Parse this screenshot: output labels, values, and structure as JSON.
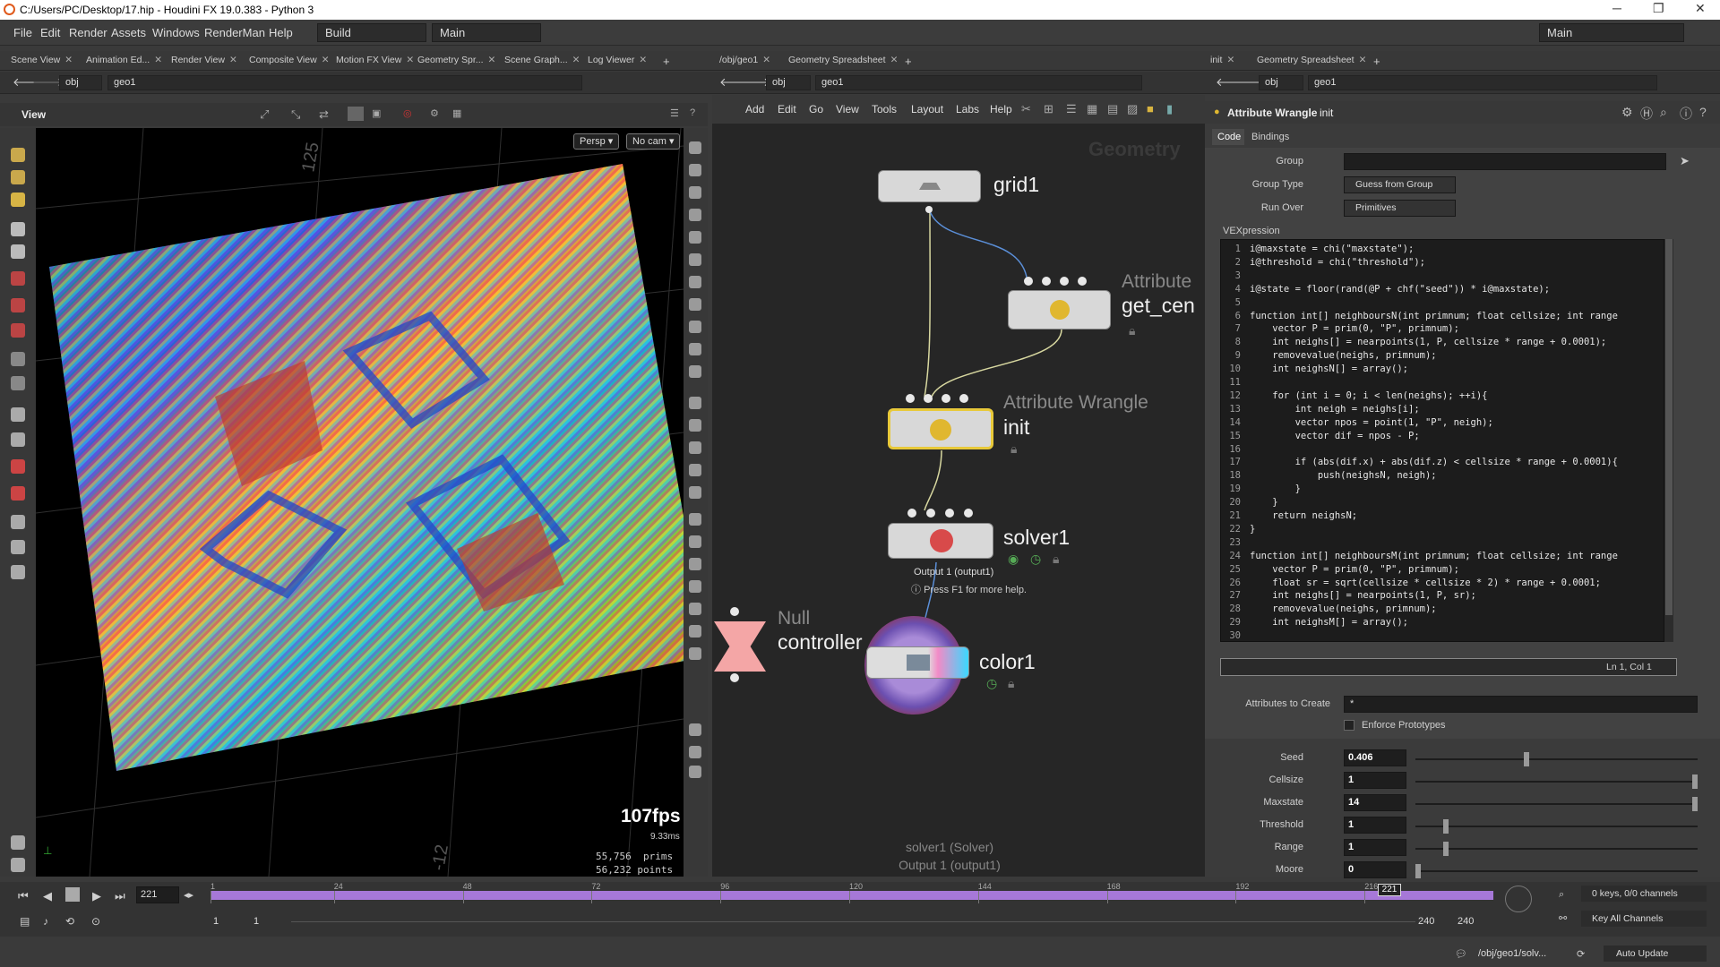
{
  "window": {
    "title": "C:/Users/PC/Desktop/17.hip - Houdini FX 19.0.383 - Python 3",
    "minimize": "─",
    "restore": "❐",
    "close": "✕"
  },
  "menu": {
    "items": [
      "File",
      "Edit",
      "Render",
      "Assets",
      "Windows",
      "RenderMan",
      "Help"
    ],
    "desktop1": "Build",
    "desktop2": "Main",
    "desktop3": "Main"
  },
  "pane_tabs_left": [
    "Scene View",
    "Animation Ed...",
    "Render View",
    "Composite View",
    "Motion FX View",
    "Geometry Spr...",
    "Scene Graph...",
    "Log Viewer"
  ],
  "pane_tabs_mid": [
    "/obj/geo1",
    "Geometry Spreadsheet"
  ],
  "pane_tabs_right": [
    "init",
    "Geometry Spreadsheet"
  ],
  "path": {
    "obj": "obj",
    "geo": "geo1"
  },
  "viewer": {
    "title": "View",
    "persp": "Persp",
    "cam": "No cam",
    "fps": "107fps",
    "ms": "9.33ms",
    "prims_count": "55,756",
    "prims_label": "prims",
    "points_count": "56,232",
    "points_label": "points",
    "grid_label1": "125",
    "grid_label2": "-12"
  },
  "network": {
    "menu": [
      "Add",
      "Edit",
      "Go",
      "View",
      "Tools",
      "Layout",
      "Labs",
      "Help"
    ],
    "watermark": "Geometry",
    "nodes": {
      "grid": "grid1",
      "attr_type": "Attribute",
      "attr_name": "get_cen",
      "init_type": "Attribute Wrangle",
      "init_name": "init",
      "solver": "solver1",
      "solver_out": "Output 1 (output1)",
      "help": "Press F1 for more help.",
      "null_type": "Null",
      "null_name": "controller",
      "color": "color1"
    },
    "footer1": "solver1 (Solver)",
    "footer2": "Output 1 (output1)"
  },
  "params": {
    "node_type": "Attribute Wrangle",
    "node_name": "init",
    "tabs": [
      "Code",
      "Bindings"
    ],
    "group_label": "Group",
    "group_value": "",
    "group_type_label": "Group Type",
    "group_type_value": "Guess from Group",
    "run_over_label": "Run Over",
    "run_over_value": "Primitives",
    "vex_label": "VEXpression",
    "cursor": "Ln 1, Col 1",
    "attr_create_label": "Attributes to Create",
    "attr_create_value": "*",
    "enforce_label": "Enforce Prototypes",
    "sliders": [
      {
        "label": "Seed",
        "value": "0.406",
        "level": 0.39
      },
      {
        "label": "Cellsize",
        "value": "1",
        "level": 1.0
      },
      {
        "label": "Maxstate",
        "value": "14",
        "level": 1.0
      },
      {
        "label": "Threshold",
        "value": "1",
        "level": 0.1
      },
      {
        "label": "Range",
        "value": "1",
        "level": 0.1
      },
      {
        "label": "Moore",
        "value": "0",
        "level": 0.0
      }
    ]
  },
  "code_lines": [
    "i@maxstate = chi(\"maxstate\");",
    "i@threshold = chi(\"threshold\");",
    "",
    "i@state = floor(rand(@P + chf(\"seed\")) * i@maxstate);",
    "",
    "function int[] neighboursN(int primnum; float cellsize; int range",
    "    vector P = prim(0, \"P\", primnum);",
    "    int neighs[] = nearpoints(1, P, cellsize * range + 0.0001);",
    "    removevalue(neighs, primnum);",
    "    int neighsN[] = array();",
    "",
    "    for (int i = 0; i < len(neighs); ++i){",
    "        int neigh = neighs[i];",
    "        vector npos = point(1, \"P\", neigh);",
    "        vector dif = npos - P;",
    "",
    "        if (abs(dif.x) + abs(dif.z) < cellsize * range + 0.0001){",
    "            push(neighsN, neigh);",
    "        }",
    "    }",
    "    return neighsN;",
    "}",
    "",
    "function int[] neighboursM(int primnum; float cellsize; int range",
    "    vector P = prim(0, \"P\", primnum);",
    "    float sr = sqrt(cellsize * cellsize * 2) * range + 0.0001;",
    "    int neighs[] = nearpoints(1, P, sr);",
    "    removevalue(neighs, primnum);",
    "    int neighsM[] = array();",
    ""
  ],
  "timeline": {
    "frame": "221",
    "ticks": [
      "1",
      "24",
      "48",
      "72",
      "96",
      "120",
      "144",
      "168",
      "192",
      "216"
    ],
    "current_marker": "221",
    "start": "1",
    "start2": "1",
    "end": "240",
    "end2": "240",
    "keys": "0 keys, 0/0 channels",
    "key_all": "Key All Channels",
    "path": "/obj/geo1/solv...",
    "auto_update": "Auto Update"
  },
  "colors": {
    "selected_node": "#e8c93a",
    "timeline_bar": "#a678d8",
    "null_node": "#f4a6a6"
  }
}
